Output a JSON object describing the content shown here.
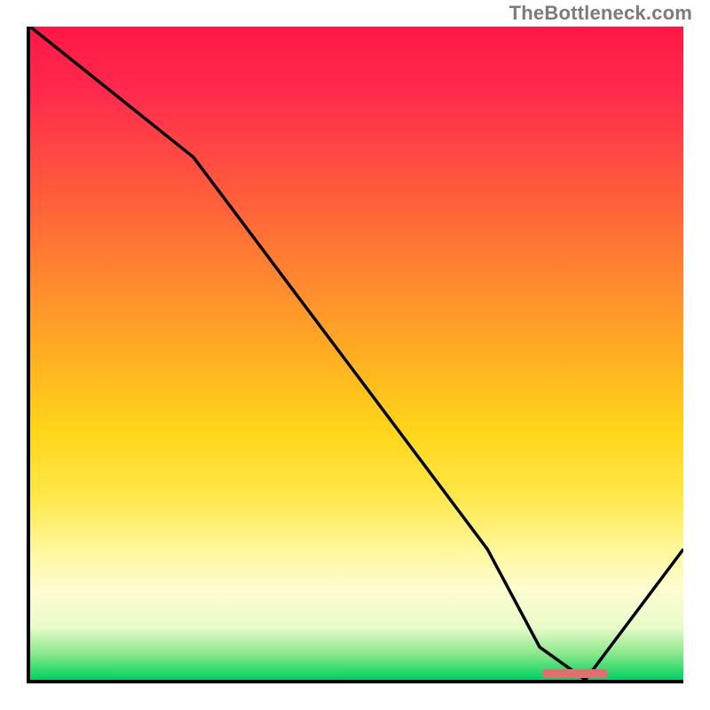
{
  "attribution": "TheBottleneck.com",
  "chart_data": {
    "type": "line",
    "title": "",
    "xlabel": "",
    "ylabel": "",
    "xlim": [
      0,
      100
    ],
    "ylim": [
      0,
      100
    ],
    "x": [
      0,
      10,
      25,
      40,
      55,
      70,
      78,
      85,
      100
    ],
    "values": [
      100,
      92,
      80,
      60,
      40,
      20,
      5,
      0,
      20
    ],
    "optimal_band": {
      "x_start": 78,
      "x_end": 88,
      "y": 0
    },
    "gradient_stops": [
      {
        "pos": 0,
        "color": "#ff1744"
      },
      {
        "pos": 40,
        "color": "#ff8c2e"
      },
      {
        "pos": 72,
        "color": "#ffe84a"
      },
      {
        "pos": 100,
        "color": "#00d060"
      }
    ]
  }
}
